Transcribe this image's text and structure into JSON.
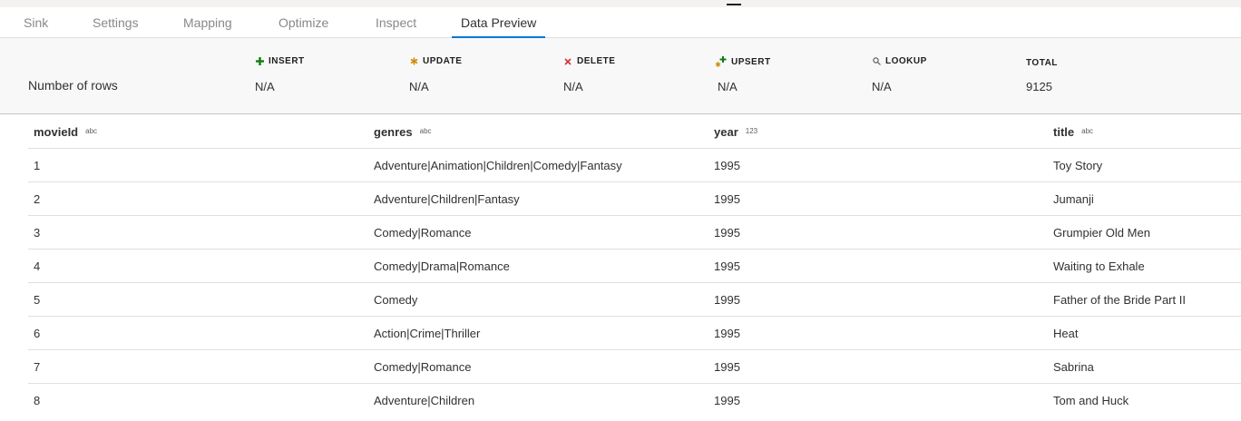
{
  "tabs": [
    {
      "label": "Sink"
    },
    {
      "label": "Settings"
    },
    {
      "label": "Mapping"
    },
    {
      "label": "Optimize"
    },
    {
      "label": "Inspect"
    },
    {
      "label": "Data Preview"
    }
  ],
  "stats": {
    "rows_label": "Number of rows",
    "insert": {
      "label": "INSERT",
      "value": "N/A",
      "icon": "plus-icon",
      "color": "#107c10"
    },
    "update": {
      "label": "UPDATE",
      "value": "N/A",
      "icon": "asterisk-icon",
      "color": "#d18b0c"
    },
    "delete": {
      "label": "DELETE",
      "value": "N/A",
      "icon": "x-icon",
      "color": "#d13438"
    },
    "upsert": {
      "label": "UPSERT",
      "value": "N/A",
      "icon": "upsert-icon",
      "color": "#107c10"
    },
    "lookup": {
      "label": "LOOKUP",
      "value": "N/A",
      "icon": "search-icon",
      "color": "#605e5c"
    },
    "total": {
      "label": "TOTAL",
      "value": "9125"
    }
  },
  "columns": [
    {
      "name": "movieId",
      "type": "abc"
    },
    {
      "name": "genres",
      "type": "abc"
    },
    {
      "name": "year",
      "type": "123"
    },
    {
      "name": "title",
      "type": "abc"
    }
  ],
  "rows": [
    [
      "1",
      "Adventure|Animation|Children|Comedy|Fantasy",
      "1995",
      "Toy Story"
    ],
    [
      "2",
      "Adventure|Children|Fantasy",
      "1995",
      "Jumanji"
    ],
    [
      "3",
      "Comedy|Romance",
      "1995",
      "Grumpier Old Men"
    ],
    [
      "4",
      "Comedy|Drama|Romance",
      "1995",
      "Waiting to Exhale"
    ],
    [
      "5",
      "Comedy",
      "1995",
      "Father of the Bride Part II"
    ],
    [
      "6",
      "Action|Crime|Thriller",
      "1995",
      "Heat"
    ],
    [
      "7",
      "Comedy|Romance",
      "1995",
      "Sabrina"
    ],
    [
      "8",
      "Adventure|Children",
      "1995",
      "Tom and Huck"
    ]
  ]
}
